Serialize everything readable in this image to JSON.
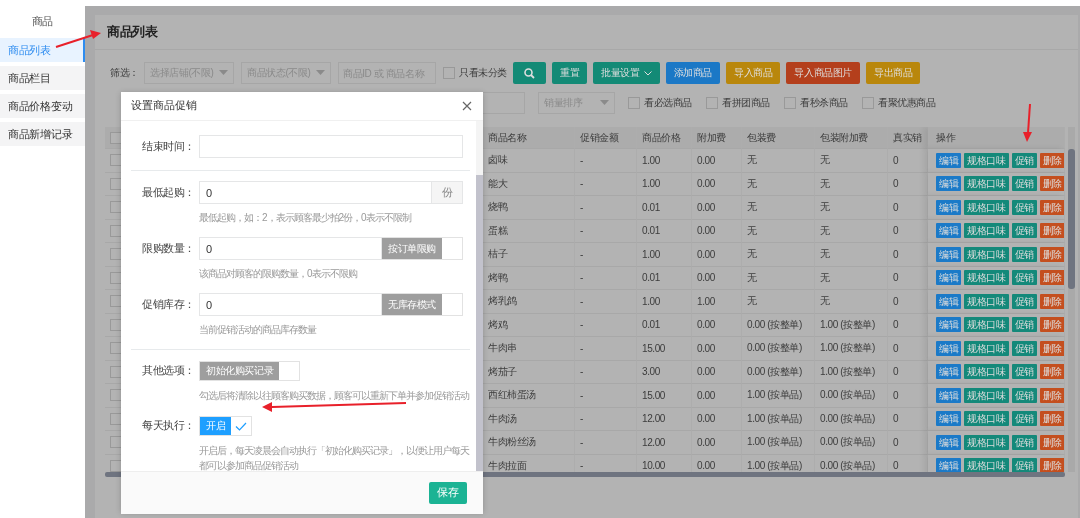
{
  "sidebar": {
    "title": "商品",
    "items": [
      {
        "label": "商品列表",
        "selected": true
      },
      {
        "label": "商品栏目",
        "selected": false
      },
      {
        "label": "商品价格变动",
        "selected": false
      },
      {
        "label": "商品新增记录",
        "selected": false
      }
    ]
  },
  "page": {
    "title": "商品列表",
    "filter_label": "筛选：",
    "selects": [
      {
        "placeholder": "选择店铺(不限)"
      },
      {
        "placeholder": "商品状态(不限)"
      }
    ],
    "search": {
      "placeholder": "商品ID 或 商品名称"
    },
    "only_uncategorized": {
      "label": "只看未分类",
      "checked": false
    },
    "buttons": [
      {
        "kind": "search",
        "color": "#138a76"
      },
      {
        "kind": "text",
        "label": "重置",
        "color": "#138a76"
      },
      {
        "kind": "dropdown",
        "label": "批量设置",
        "color": "#138a76"
      },
      {
        "kind": "text",
        "label": "添加商品",
        "color": "#1b78c6"
      },
      {
        "kind": "text",
        "label": "导入商品",
        "color": "#b9870c"
      },
      {
        "kind": "text",
        "label": "导入商品图片",
        "color": "#b43f1c"
      },
      {
        "kind": "text",
        "label": "导出商品",
        "color": "#b9870c"
      }
    ],
    "sort": {
      "placeholder": "销量排序"
    },
    "checkboxes": [
      {
        "label": "看必选商品",
        "checked": false
      },
      {
        "label": "看拼团商品",
        "checked": false
      },
      {
        "label": "看秒杀商品",
        "checked": false
      },
      {
        "label": "看聚优惠商品",
        "checked": false
      }
    ]
  },
  "table": {
    "all_checked": false,
    "columns": [
      "商品名称",
      "促销金额",
      "商品价格",
      "附加费",
      "包装费",
      "包装附加费",
      "真实销",
      "操作"
    ],
    "rows": [
      {
        "checked": false,
        "cells": [
          "卤味",
          "-",
          "1.00",
          "0.00",
          "无",
          "无",
          "0"
        ],
        "actions": [
          {
            "label": "编辑",
            "color": "#1b7ac8"
          },
          {
            "label": "规格口味",
            "color": "#14897a"
          },
          {
            "label": "促销",
            "color": "#14897a"
          },
          {
            "label": "删除",
            "color": "#c44f1f"
          }
        ]
      },
      {
        "checked": false,
        "cells": [
          "能大",
          "-",
          "1.00",
          "0.00",
          "无",
          "无",
          "0"
        ],
        "actions": [
          {
            "label": "编辑",
            "color": "#1b7ac8"
          },
          {
            "label": "规格口味",
            "color": "#14897a"
          },
          {
            "label": "促销",
            "color": "#14897a"
          },
          {
            "label": "删除",
            "color": "#c44f1f"
          }
        ]
      },
      {
        "checked": false,
        "cells": [
          "烧鸭",
          "-",
          "0.01",
          "0.00",
          "无",
          "无",
          "0"
        ],
        "actions": [
          {
            "label": "编辑",
            "color": "#1b7ac8"
          },
          {
            "label": "规格口味",
            "color": "#14897a"
          },
          {
            "label": "促销",
            "color": "#14897a"
          },
          {
            "label": "删除",
            "color": "#c44f1f"
          }
        ]
      },
      {
        "checked": false,
        "cells": [
          "蛋糕",
          "-",
          "0.01",
          "0.00",
          "无",
          "无",
          "0"
        ],
        "actions": [
          {
            "label": "编辑",
            "color": "#1b7ac8"
          },
          {
            "label": "规格口味",
            "color": "#14897a"
          },
          {
            "label": "促销",
            "color": "#14897a"
          },
          {
            "label": "删除",
            "color": "#c44f1f"
          }
        ]
      },
      {
        "checked": false,
        "cells": [
          "桔子",
          "-",
          "1.00",
          "0.00",
          "无",
          "无",
          "0"
        ],
        "actions": [
          {
            "label": "编辑",
            "color": "#1b7ac8"
          },
          {
            "label": "规格口味",
            "color": "#14897a"
          },
          {
            "label": "促销",
            "color": "#14897a"
          },
          {
            "label": "删除",
            "color": "#c44f1f"
          }
        ]
      },
      {
        "checked": false,
        "cells": [
          "烤鸭",
          "-",
          "0.01",
          "0.00",
          "无",
          "无",
          "0"
        ],
        "actions": [
          {
            "label": "编辑",
            "color": "#1b7ac8"
          },
          {
            "label": "规格口味",
            "color": "#14897a"
          },
          {
            "label": "促销",
            "color": "#14897a"
          },
          {
            "label": "删除",
            "color": "#c44f1f"
          }
        ]
      },
      {
        "checked": false,
        "cells": [
          "烤乳鸽",
          "-",
          "1.00",
          "1.00",
          "无",
          "无",
          "0"
        ],
        "actions": [
          {
            "label": "编辑",
            "color": "#1b7ac8"
          },
          {
            "label": "规格口味",
            "color": "#14897a"
          },
          {
            "label": "促销",
            "color": "#14897a"
          },
          {
            "label": "删除",
            "color": "#c44f1f"
          }
        ]
      },
      {
        "checked": false,
        "cells": [
          "烤鸡",
          "-",
          "0.01",
          "0.00",
          "0.00 (按整单)",
          "1.00 (按整单)",
          "0"
        ],
        "actions": [
          {
            "label": "编辑",
            "color": "#1b7ac8"
          },
          {
            "label": "规格口味",
            "color": "#14897a"
          },
          {
            "label": "促销",
            "color": "#14897a"
          },
          {
            "label": "删除",
            "color": "#c44f1f"
          }
        ]
      },
      {
        "checked": false,
        "cells": [
          "牛肉串",
          "-",
          "15.00",
          "0.00",
          "0.00 (按整单)",
          "1.00 (按整单)",
          "0"
        ],
        "actions": [
          {
            "label": "编辑",
            "color": "#1b7ac8"
          },
          {
            "label": "规格口味",
            "color": "#14897a"
          },
          {
            "label": "促销",
            "color": "#14897a"
          },
          {
            "label": "删除",
            "color": "#c44f1f"
          }
        ]
      },
      {
        "checked": false,
        "cells": [
          "烤茄子",
          "-",
          "3.00",
          "0.00",
          "0.00 (按整单)",
          "1.00 (按整单)",
          "0"
        ],
        "actions": [
          {
            "label": "编辑",
            "color": "#1b7ac8"
          },
          {
            "label": "规格口味",
            "color": "#14897a"
          },
          {
            "label": "促销",
            "color": "#14897a"
          },
          {
            "label": "删除",
            "color": "#c44f1f"
          }
        ]
      },
      {
        "checked": false,
        "cells": [
          "西红柿蛋汤",
          "-",
          "15.00",
          "0.00",
          "1.00 (按单品)",
          "0.00 (按单品)",
          "0"
        ],
        "actions": [
          {
            "label": "编辑",
            "color": "#1b7ac8"
          },
          {
            "label": "规格口味",
            "color": "#14897a"
          },
          {
            "label": "促销",
            "color": "#14897a"
          },
          {
            "label": "删除",
            "color": "#c44f1f"
          }
        ]
      },
      {
        "checked": false,
        "cells": [
          "牛肉汤",
          "-",
          "12.00",
          "0.00",
          "1.00 (按单品)",
          "0.00 (按单品)",
          "0"
        ],
        "actions": [
          {
            "label": "编辑",
            "color": "#1b7ac8"
          },
          {
            "label": "规格口味",
            "color": "#14897a"
          },
          {
            "label": "促销",
            "color": "#14897a"
          },
          {
            "label": "删除",
            "color": "#c44f1f"
          }
        ]
      },
      {
        "checked": false,
        "cells": [
          "牛肉粉丝汤",
          "-",
          "12.00",
          "0.00",
          "1.00 (按单品)",
          "0.00 (按单品)",
          "0"
        ],
        "actions": [
          {
            "label": "编辑",
            "color": "#1b7ac8"
          },
          {
            "label": "规格口味",
            "color": "#14897a"
          },
          {
            "label": "促销",
            "color": "#14897a"
          },
          {
            "label": "删除",
            "color": "#c44f1f"
          }
        ]
      },
      {
        "checked": false,
        "cells": [
          "牛肉拉面",
          "-",
          "10.00",
          "0.00",
          "1.00 (按单品)",
          "0.00 (按单品)",
          "0"
        ],
        "actions": [
          {
            "label": "编辑",
            "color": "#1b7ac8"
          },
          {
            "label": "规格口味",
            "color": "#14897a"
          },
          {
            "label": "促销",
            "color": "#14897a"
          },
          {
            "label": "删除",
            "color": "#c44f1f"
          }
        ]
      }
    ]
  },
  "modal": {
    "title": "设置商品促销",
    "sections": [
      {
        "fields": [
          {
            "kind": "input",
            "label": "结束时间："
          }
        ]
      },
      {
        "fields": [
          {
            "kind": "input",
            "label": "最低起购：",
            "value": "0",
            "addon": "份",
            "hint": "最低起购，如：2，表示顾客最少拍2份，0表示不限制"
          },
          {
            "kind": "input",
            "label": "限购数量：",
            "value": "0",
            "switch": {
              "label": "按订单限购",
              "on": false
            },
            "hint": "该商品对顾客的限购数量，0表示不限购"
          },
          {
            "kind": "input",
            "label": "促销库存：",
            "value": "0",
            "switch": {
              "label": "无库存模式",
              "on": false
            },
            "hint": "当前促销活动的商品库存数量"
          }
        ]
      },
      {
        "fields": [
          {
            "kind": "switch",
            "label": "其他选项：",
            "switch": {
              "label": "初始化购买记录",
              "on": false
            },
            "hint": "勾选后将清除以往顾客购买数据，顾客可以重新下单并参加促销活动"
          },
          {
            "kind": "switch",
            "label": "每天执行：",
            "switch": {
              "label": "开启",
              "on": true
            },
            "hint": "开启后，每天凌晨会自动执行「初始化购买记录」，以便让用户每天都可以参加商品促销活动"
          }
        ]
      }
    ],
    "save": "保存"
  }
}
